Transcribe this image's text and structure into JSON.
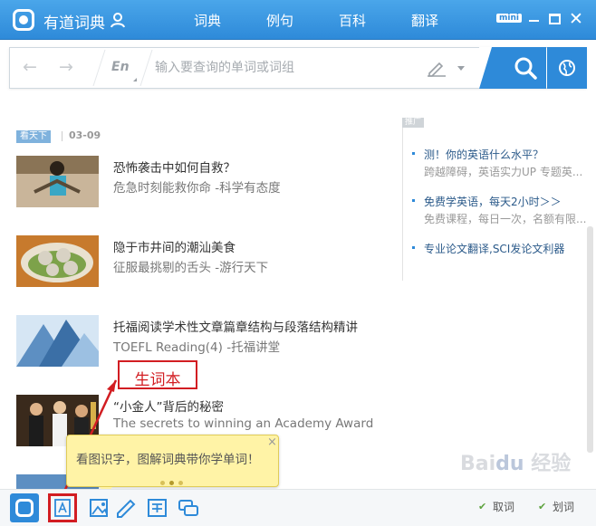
{
  "app": {
    "title": "有道词典"
  },
  "nav": {
    "tabs": [
      {
        "label": "词典",
        "active": true
      },
      {
        "label": "例句",
        "active": false
      },
      {
        "label": "百科",
        "active": false
      },
      {
        "label": "翻译",
        "active": false
      }
    ],
    "mini_label": "mini"
  },
  "search": {
    "lang_label": "En",
    "placeholder": "输入要查询的单词或词组",
    "value": ""
  },
  "feed": {
    "tag_label": "看天下",
    "date": "03-09",
    "items": [
      {
        "title": "恐怖袭击中如何自救？",
        "subtitle": "危急时刻能救你命",
        "source": " -科学有态度"
      },
      {
        "title": "隐于市井间的潮汕美食",
        "subtitle": "征服最挑剔的舌头",
        "source": " -游行天下"
      },
      {
        "title": "托福阅读学术性文章篇章结构与段落结构精讲",
        "subtitle": "TOEFL Reading(4)",
        "source": " -托福讲堂"
      },
      {
        "title": "“小金人”背后的秘密",
        "subtitle": "The secrets to winning an Academy Award",
        "source": ""
      }
    ]
  },
  "sidebar": {
    "ad_label": "推广",
    "items": [
      {
        "title": "测！你的英语什么水平？",
        "subtitle": "跨越障碍，英语实力UP 专题英..."
      },
      {
        "title": "免费学英语，每天2小时＞＞",
        "subtitle": "免费课程，每日一次，名额有限..."
      },
      {
        "title": "专业论文翻译,SCI发论文利器",
        "subtitle": ""
      }
    ]
  },
  "annotation": {
    "label": "生词本"
  },
  "tooltip": {
    "text": "看图识字，图解词典带你学单词！",
    "close": "×"
  },
  "bottombar": {
    "tools": [
      "home",
      "wordbook",
      "picture-dictionary",
      "write",
      "translate",
      "chat"
    ],
    "options": [
      {
        "label": "取词",
        "checked": true
      },
      {
        "label": "划词",
        "checked": true
      }
    ]
  },
  "watermark": "Baidu 经验",
  "colors": {
    "accent": "#2e8ad9",
    "annotation": "#d21d22",
    "tooltip_bg": "#fff3a6"
  }
}
